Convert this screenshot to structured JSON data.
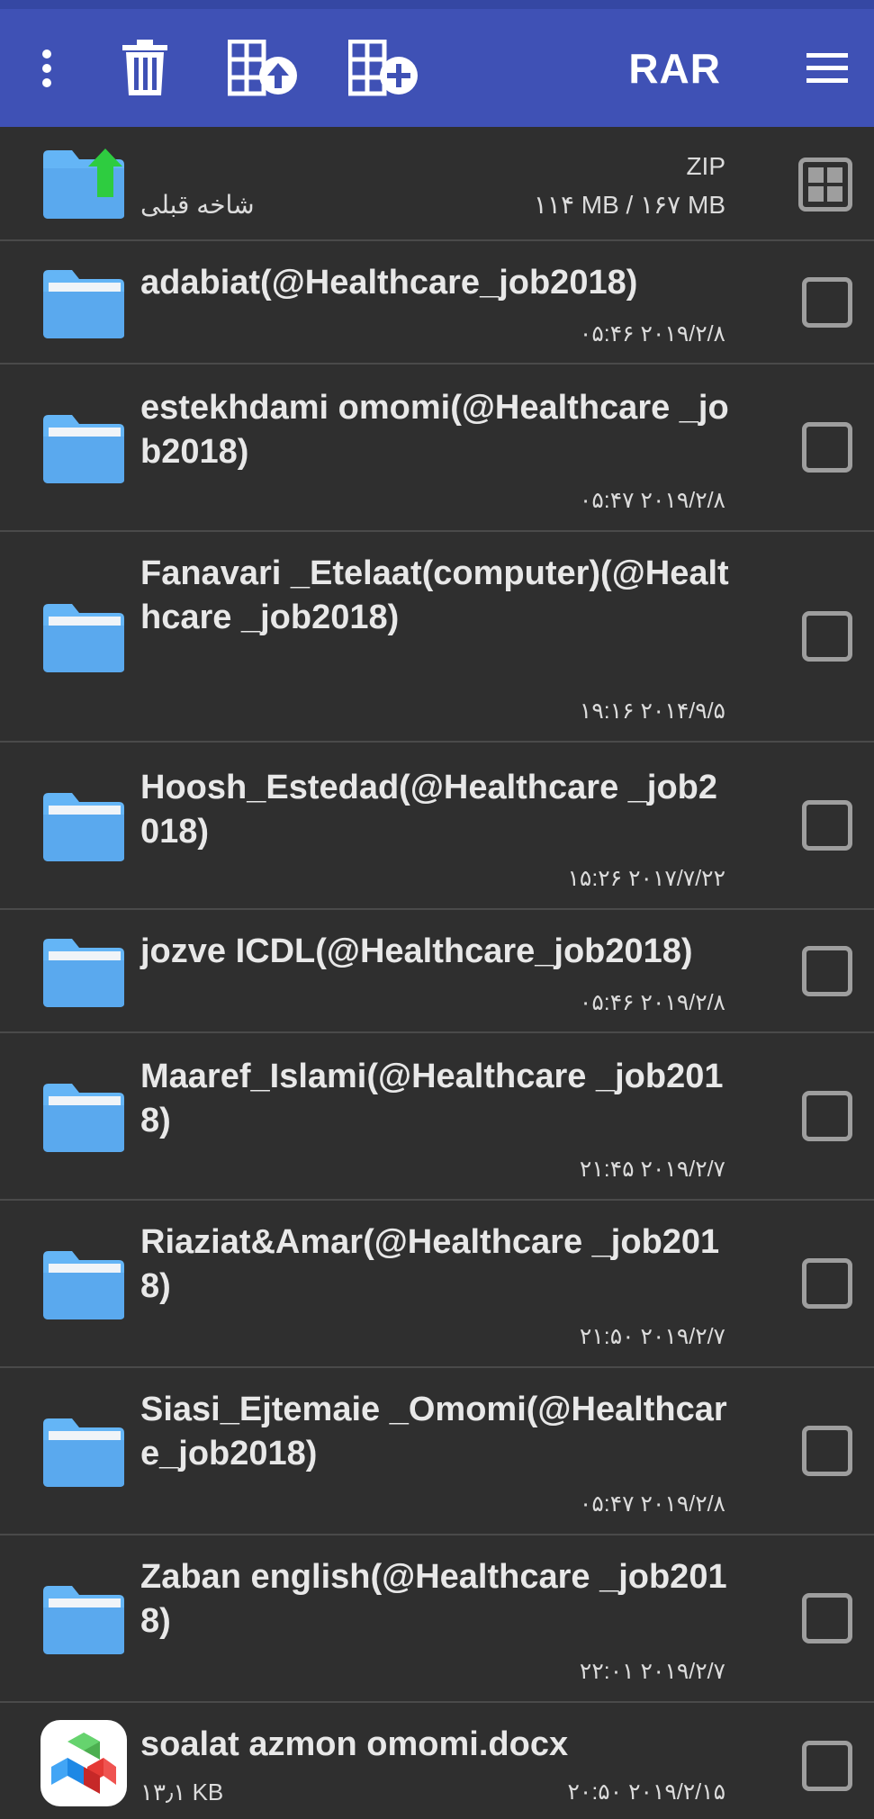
{
  "toolbar": {
    "title": "RAR",
    "icons": [
      "more-vert-icon",
      "trash-icon",
      "extract-icon",
      "add-archive-icon",
      "hamburger-menu-icon"
    ]
  },
  "colors": {
    "toolbar": "#3f51b5",
    "background": "#2f2f2f",
    "folder": "#64b5f6",
    "up_arrow": "#2ecc40"
  },
  "up_row": {
    "label": "شاخه قبلی",
    "archive_type": "ZIP",
    "size": "۱۱۴ MB / ۱۶۷ MB"
  },
  "files": [
    {
      "name": "adabiat(@Healthcare_job2018)",
      "date": "۲۰۱۹/۲/۸ ۰۵:۴۶",
      "type": "folder"
    },
    {
      "name": "estekhdami omomi(@Healthcare _job2018)",
      "date": "۲۰۱۹/۲/۸ ۰۵:۴۷",
      "type": "folder"
    },
    {
      "name": "Fanavari _Etelaat(computer)(@Healthcare _job2018)",
      "date": "۲۰۱۴/۹/۵ ۱۹:۱۶",
      "type": "folder"
    },
    {
      "name": "Hoosh_Estedad(@Healthcare _job2018)",
      "date": "۲۰۱۷/۷/۲۲ ۱۵:۲۶",
      "type": "folder"
    },
    {
      "name": "jozve ICDL(@Healthcare_job2018)",
      "date": "۲۰۱۹/۲/۸ ۰۵:۴۶",
      "type": "folder"
    },
    {
      "name": "Maaref_Islami(@Healthcare _job2018)",
      "date": "۲۰۱۹/۲/۷ ۲۱:۴۵",
      "type": "folder"
    },
    {
      "name": "Riaziat&Amar(@Healthcare _job2018)",
      "date": "۲۰۱۹/۲/۷ ۲۱:۵۰",
      "type": "folder"
    },
    {
      "name": "Siasi_Ejtemaie _Omomi(@Healthcare_job2018)",
      "date": "۲۰۱۹/۲/۸ ۰۵:۴۷",
      "type": "folder"
    },
    {
      "name": "Zaban english(@Healthcare _job2018)",
      "date": "۲۰۱۹/۲/۷ ۲۲:۰۱",
      "type": "folder"
    },
    {
      "name": "soalat  azmon omomi.docx",
      "date": "۲۰۱۹/۲/۱۵ ۲۰:۵۰",
      "size": "۱۳٫۱ KB",
      "type": "docx"
    }
  ]
}
